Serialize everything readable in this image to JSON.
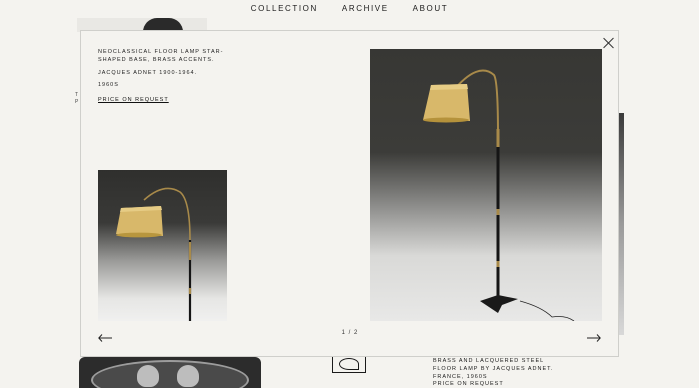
{
  "nav": {
    "items": [
      "COLLECTION",
      "ARCHIVE",
      "ABOUT"
    ]
  },
  "background": {
    "left_text_lines": [
      "T",
      "P"
    ],
    "caption": "BRASS AND LACQUERED STEEL FLOOR LAMP BY JACQUES ADNET. FRANCE, 1960S",
    "price": "PRICE ON REQUEST"
  },
  "modal": {
    "title": "NEOCLASSICAL FLOOR LAMP STAR-SHAPED BASE, BRASS ACCENTS.",
    "designer": "JACQUES ADNET 1900-1964.",
    "year": "1960S",
    "price_link": "PRICE ON REQUEST",
    "counter": "1 / 2",
    "icons": {
      "close": "close-icon",
      "prev": "arrow-left-icon",
      "next": "arrow-right-icon"
    }
  },
  "colors": {
    "background": "#f4f3ef",
    "text": "#1a1a1a",
    "shade": "#d8b86a",
    "brass": "#a88a4a"
  }
}
